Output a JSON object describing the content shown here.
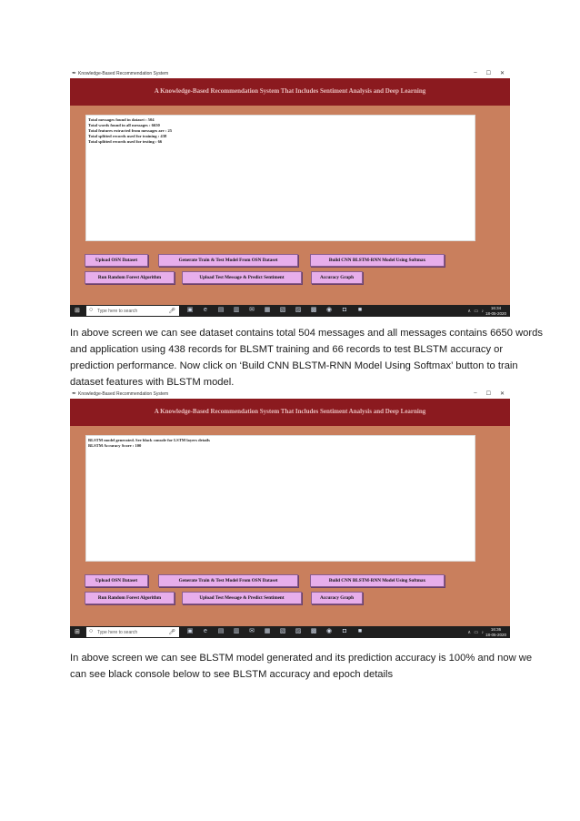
{
  "window": {
    "title": "Knowledge-Based Recommendation System",
    "controls": [
      "–",
      "☐",
      "✕"
    ],
    "app_heading": "A Knowledge-Based Recommendation System That Includes Sentiment Analysis and Deep Learning"
  },
  "buttons": {
    "upload_osn": "Upload OSN Dataset",
    "generate_train_test": "Generate Train & Test Model From OSN Dataset",
    "build_cnn": "Build CNN BLSTM-RNN Model Using Softmax",
    "random_forest": "Run Random Forest Algorithm",
    "upload_test_msg": "Upload Test Message & Predict Sentiment",
    "accuracy_graph": "Accuracy Graph"
  },
  "screenshot1": {
    "output_lines": [
      "Total messages found in dataset : 504",
      "Total words found in all messages : 6650",
      "Total features extracted from messages are : 25",
      "Total splitted records used for training : 438",
      "Total splitted records used for testing : 66"
    ],
    "taskbar": {
      "search_placeholder": "Type here to search",
      "time": "16:34",
      "date": "18-05-2020"
    }
  },
  "paragraph1": [
    "In above screen we can see dataset contains total 504 messages and all messages contains 6650 words",
    "and application using 438 records for BLSMT training and 66 records to test BLSTM accuracy or",
    "prediction performance. Now click on ‘Build CNN BLSTM-RNN Model Using Softmax’ button to train",
    "dataset features with BLSTM model."
  ],
  "screenshot2": {
    "output_lines": [
      "BLSTM model generated. See black console for LSTM layers details",
      "BLSTM Accuracy Score : 100"
    ],
    "taskbar": {
      "search_placeholder": "Type here to search",
      "time": "16:36",
      "date": "18-05-2020"
    }
  },
  "paragraph2": [
    "In above screen we can see BLSTM model generated and its prediction accuracy is 100% and now we",
    "can see black console below to see BLSTM accuracy and epoch details"
  ],
  "icons": [
    "feather-icon",
    "windows-start-icon",
    "search-icon",
    "microphone-icon",
    "task-view-icon",
    "edge-icon",
    "file-explorer-icon",
    "store-icon",
    "mail-icon",
    "app-icon"
  ]
}
